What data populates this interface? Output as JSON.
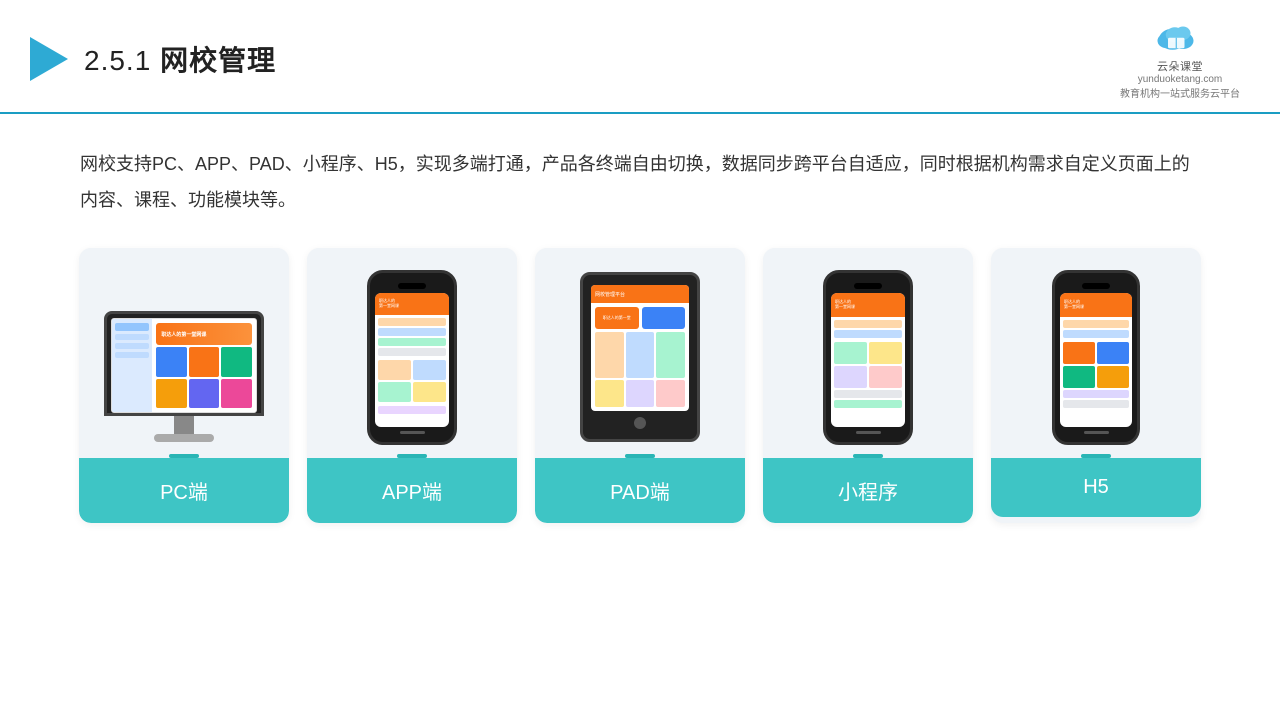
{
  "header": {
    "section_number": "2.5.1",
    "title": "网校管理",
    "logo_name": "云朵课堂",
    "logo_url": "yunduoketang.com",
    "logo_slogan": "教育机构一站\n式服务云平台"
  },
  "description": {
    "text": "网校支持PC、APP、PAD、小程序、H5，实现多端打通，产品各终端自由切换，数据同步跨平台自适应，同时根据机构需求自定义页面上的内容、课程、功能模块等。"
  },
  "cards": [
    {
      "id": "pc",
      "label": "PC端"
    },
    {
      "id": "app",
      "label": "APP端"
    },
    {
      "id": "pad",
      "label": "PAD端"
    },
    {
      "id": "miniprogram",
      "label": "小程序"
    },
    {
      "id": "h5",
      "label": "H5"
    }
  ],
  "colors": {
    "accent": "#3ec5c5",
    "header_line": "#1a9dc3",
    "play_icon": "#2eaad4"
  }
}
